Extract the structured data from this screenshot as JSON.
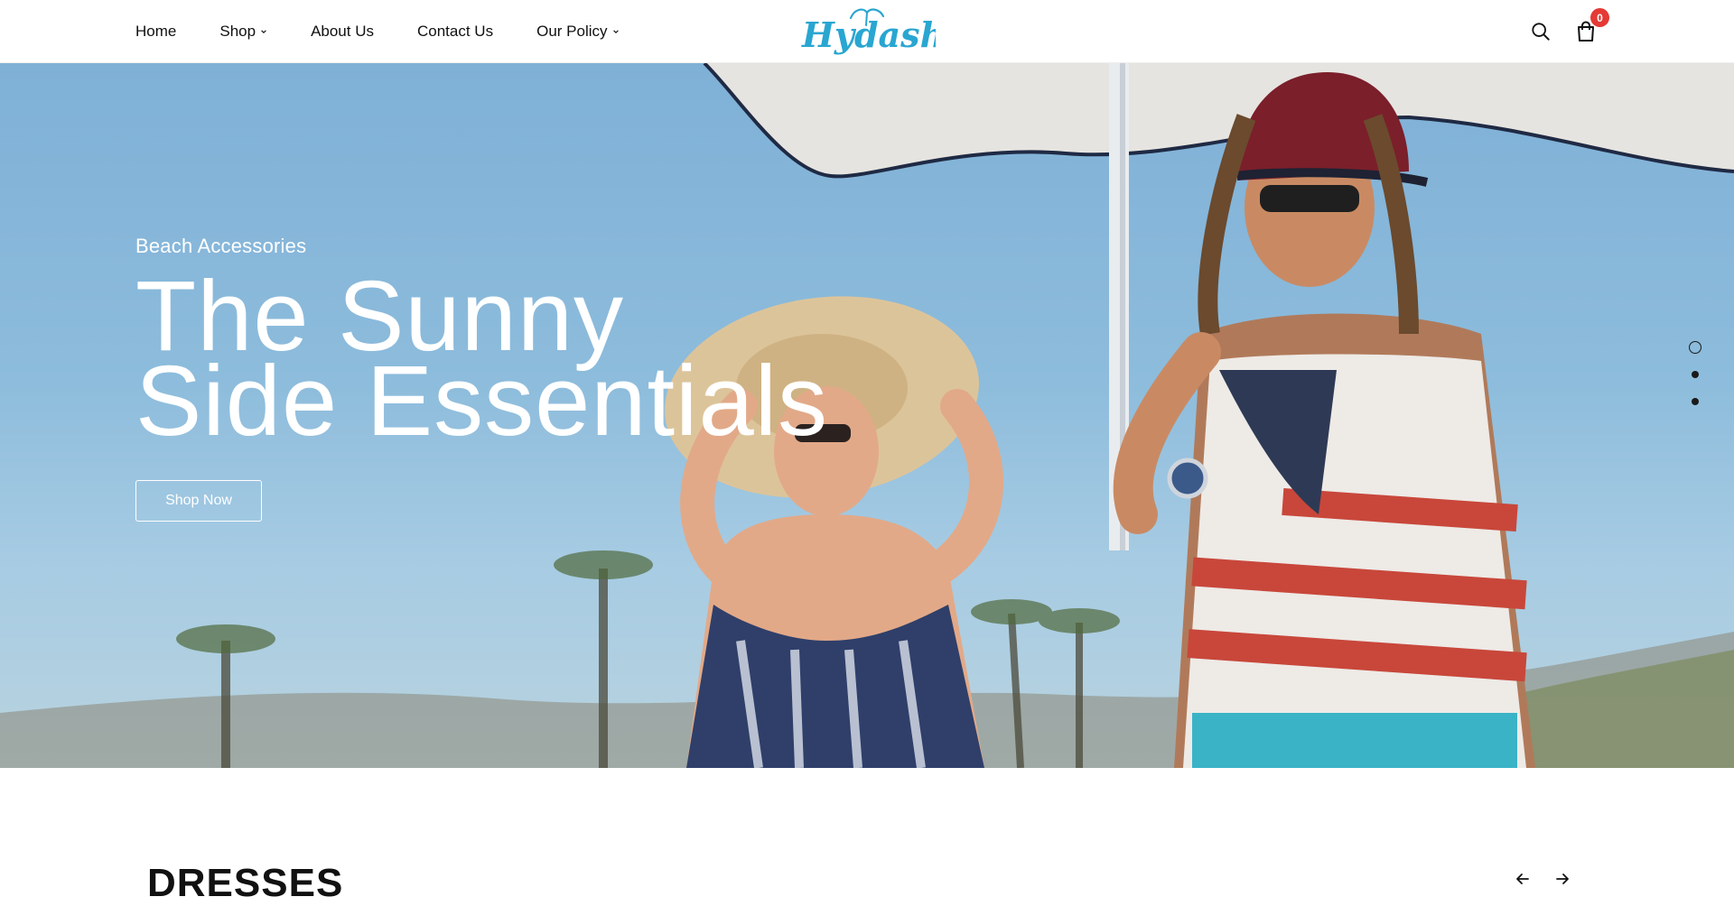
{
  "header": {
    "nav": [
      {
        "label": "Home"
      },
      {
        "label": "Shop"
      },
      {
        "label": "About Us"
      },
      {
        "label": "Contact Us"
      },
      {
        "label": "Our Policy"
      }
    ],
    "logo_text": "Hydashop",
    "cart_count": "0",
    "icons": [
      "search-icon",
      "shopping-bag-icon",
      "chevron-down-icon"
    ]
  },
  "hero": {
    "eyebrow": "Beach Accessories",
    "title_line1": "The Sunny",
    "title_line2": "Side Essentials",
    "cta_label": "Shop Now",
    "active_slide": 1,
    "slide_count": 3
  },
  "section": {
    "title": "DRESSES"
  },
  "colors": {
    "accent_logo": "#29a6d1",
    "badge": "#e53935",
    "text": "#111111"
  }
}
